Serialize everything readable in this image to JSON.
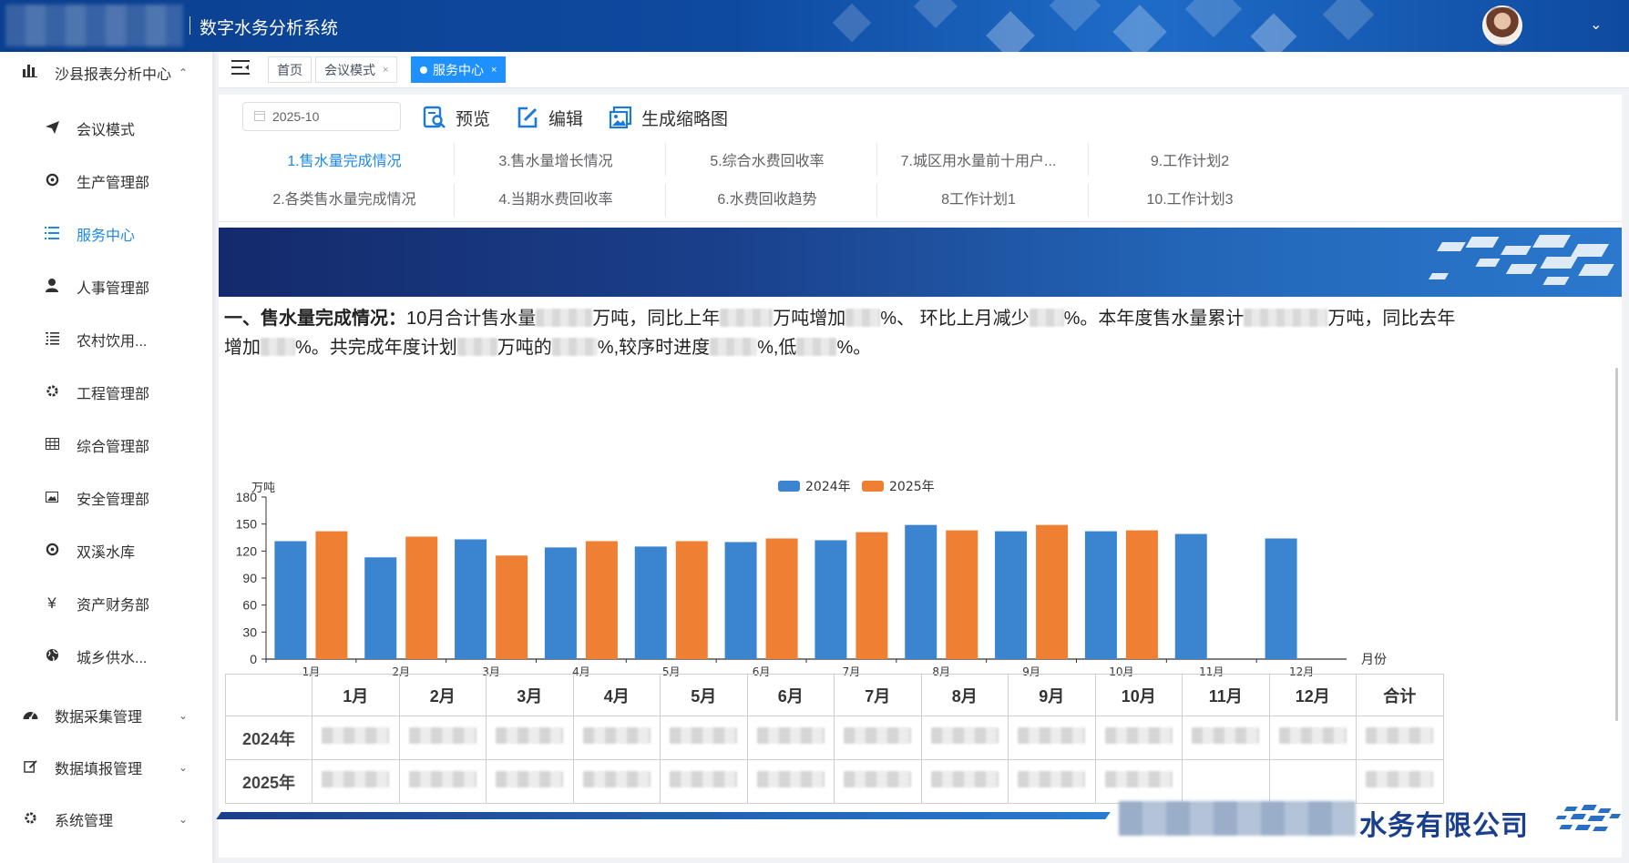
{
  "header": {
    "app_title": "数字水务分析系统",
    "user_menu_icon": "chevron-down-icon"
  },
  "sidebar": {
    "groups": [
      {
        "label": "沙县报表分析中心",
        "icon": "bar-chart-icon",
        "expanded": true
      },
      {
        "label": "数据采集管理",
        "icon": "dashboard-icon",
        "expanded": false
      },
      {
        "label": "数据填报管理",
        "icon": "edit-icon",
        "expanded": false
      },
      {
        "label": "系统管理",
        "icon": "gear-icon",
        "expanded": false
      }
    ],
    "items": [
      {
        "label": "会议模式",
        "icon": "send-icon"
      },
      {
        "label": "生产管理部",
        "icon": "target-icon"
      },
      {
        "label": "服务中心",
        "icon": "list-icon",
        "active": true
      },
      {
        "label": "人事管理部",
        "icon": "user-icon"
      },
      {
        "label": "农村饮用...",
        "icon": "ordered-list-icon"
      },
      {
        "label": "工程管理部",
        "icon": "gear-icon"
      },
      {
        "label": "综合管理部",
        "icon": "grid-icon"
      },
      {
        "label": "安全管理部",
        "icon": "image-icon"
      },
      {
        "label": "双溪水库",
        "icon": "target-icon"
      },
      {
        "label": "资产财务部",
        "icon": "yen-icon"
      },
      {
        "label": "城乡供水...",
        "icon": "globe-icon"
      }
    ]
  },
  "tabs": [
    {
      "label": "首页",
      "closable": false
    },
    {
      "label": "会议模式",
      "closable": true
    },
    {
      "label": "服务中心",
      "closable": true,
      "active": true
    }
  ],
  "tab_close_glyph": "×",
  "toolbar": {
    "date_value": "2025-10",
    "preview_label": "预览",
    "edit_label": "编辑",
    "thumbnail_label": "生成缩略图"
  },
  "report_nav": {
    "row1": [
      "1.售水量完成情况",
      "3.售水量增长情况",
      "5.综合水费回收率",
      "7.城区用水量前十用户...",
      "9.工作计划2"
    ],
    "row2": [
      "2.各类售水量完成情况",
      "4.当期水费回收率",
      "6.水费回收趋势",
      "8工作计划1",
      "10.工作计划3"
    ],
    "active": "1.售水量完成情况"
  },
  "summary": {
    "heading": "一、售水量完成情况：",
    "p1": "10月合计售水量",
    "p2": "万吨，同比上年",
    "p3": "万吨增加",
    "p4": "%、 环比上月减少",
    "p5": "%。本年度售水量累计",
    "p6": "万吨，同比去年",
    "p7": "增加",
    "p8": "%。共完成年度计划",
    "p9": "万吨的",
    "p10": "%,较序时进度",
    "p11": "%,低",
    "p12": "%。"
  },
  "chart_data": {
    "type": "bar",
    "categories": [
      "1月",
      "2月",
      "3月",
      "4月",
      "5月",
      "6月",
      "7月",
      "8月",
      "9月",
      "10月",
      "11月",
      "12月"
    ],
    "series": [
      {
        "name": "2024年",
        "color": "#3a84d0",
        "values": [
          131,
          113,
          133,
          124,
          125,
          130,
          132,
          149,
          142,
          142,
          139,
          134
        ]
      },
      {
        "name": "2025年",
        "color": "#ee7f33",
        "values": [
          142,
          136,
          115,
          131,
          131,
          134,
          141,
          143,
          149,
          143,
          null,
          null
        ]
      }
    ],
    "ylabel": "万吨",
    "xlabel": "月份",
    "ylim": [
      0,
      180
    ],
    "yticks": [
      0,
      30,
      60,
      90,
      120,
      150,
      180
    ],
    "legend": "top-center",
    "grid": false
  },
  "table": {
    "corner": "",
    "headers": [
      "1月",
      "2月",
      "3月",
      "4月",
      "5月",
      "6月",
      "7月",
      "8月",
      "9月",
      "10月",
      "11月",
      "12月",
      "合计"
    ],
    "rows": [
      {
        "label": "2024年",
        "filled": [
          true,
          true,
          true,
          true,
          true,
          true,
          true,
          true,
          true,
          true,
          true,
          true,
          true
        ]
      },
      {
        "label": "2025年",
        "filled": [
          true,
          true,
          true,
          true,
          true,
          true,
          true,
          true,
          true,
          true,
          false,
          false,
          true
        ]
      }
    ]
  },
  "footer": {
    "company_suffix": "水务有限公司"
  }
}
